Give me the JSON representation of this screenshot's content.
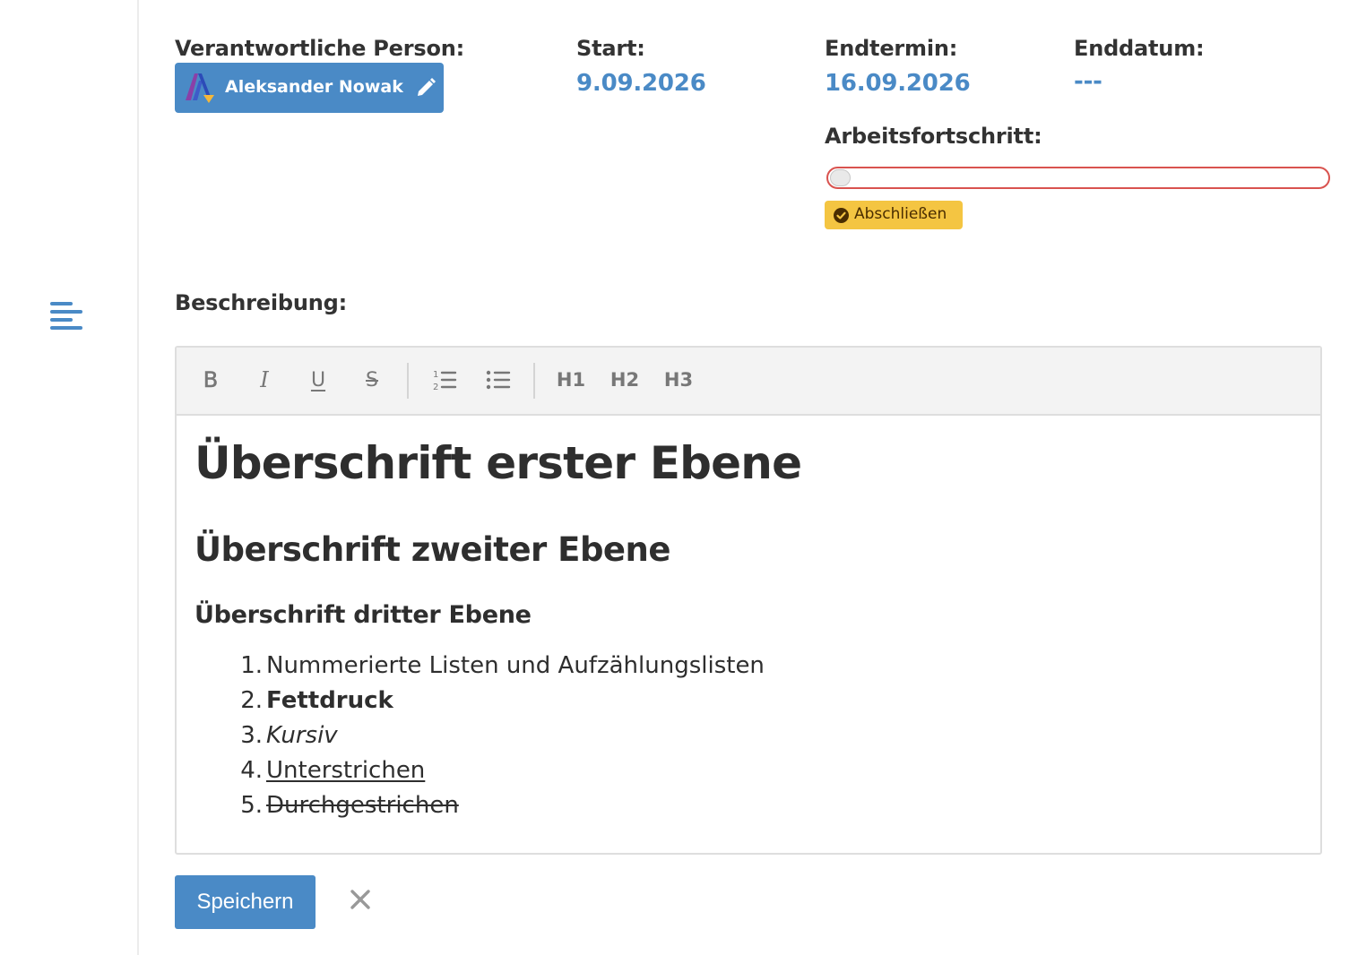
{
  "details": {
    "responsible_label": "Verantwortliche Person:",
    "responsible_name": "Aleksander Nowak",
    "start_label": "Start:",
    "start_value": "9.09.2026",
    "deadline_label": "Endtermin:",
    "deadline_value": "16.09.2026",
    "end_date_label": "Enddatum:",
    "end_date_value": "---",
    "progress_label": "Arbeitsfortschritt:",
    "progress_percent": 0,
    "complete_button": "Abschließen"
  },
  "description": {
    "label": "Beschreibung:",
    "toolbar": {
      "bold": "B",
      "italic": "I",
      "underline": "U",
      "strike": "S",
      "h1": "H1",
      "h2": "H2",
      "h3": "H3"
    },
    "content": {
      "h1": "Überschrift erster Ebene",
      "h2": "Überschrift zweiter Ebene",
      "h3": "Überschrift dritter Ebene",
      "list": [
        {
          "num": "1.",
          "text": "Nummerierte Listen und Aufzählungslisten"
        },
        {
          "num": "2.",
          "text": "Fettdruck"
        },
        {
          "num": "3.",
          "text": "Kursiv"
        },
        {
          "num": "4.",
          "text": "Unterstrichen"
        },
        {
          "num": "5.",
          "text": "Durchgestrichen"
        }
      ]
    }
  },
  "actions": {
    "save": "Speichern"
  },
  "colors": {
    "accent": "#4a8ac6",
    "warning": "#f4c542",
    "danger": "#d9534f"
  },
  "icons": {
    "description": "align-left-icon",
    "avatar": "logo-avatar-icon",
    "edit": "pencil-icon",
    "complete": "check-circle-icon",
    "ordered_list": "ordered-list-icon",
    "bullet_list": "bullet-list-icon",
    "cancel": "close-icon"
  }
}
